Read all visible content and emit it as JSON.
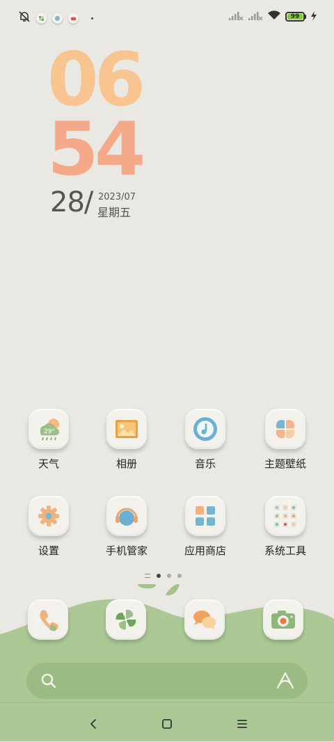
{
  "status_bar": {
    "battery_level": "99",
    "battery_color": "#7fcd33",
    "left_icons": [
      "bell-muted-icon",
      "pinwheel-app-icon",
      "security-app-icon",
      "app-store-icon"
    ],
    "right_icons": [
      "signal-no-service-icon",
      "signal-no-service-icon",
      "wifi-icon",
      "battery-icon",
      "charging-bolt-icon"
    ]
  },
  "clock": {
    "hour": "06",
    "minute": "54",
    "day": "28/",
    "year_month": "2023/07",
    "weekday": "星期五",
    "hour_color": "#f8c591",
    "minute_color": "#f5a988"
  },
  "apps": [
    {
      "label": "天气",
      "icon": "weather-icon",
      "temp": "29°"
    },
    {
      "label": "相册",
      "icon": "gallery-icon"
    },
    {
      "label": "音乐",
      "icon": "music-icon"
    },
    {
      "label": "主题壁纸",
      "icon": "themes-icon"
    },
    {
      "label": "设置",
      "icon": "settings-gear-icon"
    },
    {
      "label": "手机管家",
      "icon": "security-headphones-icon"
    },
    {
      "label": "应用商店",
      "icon": "app-store-grid-icon"
    },
    {
      "label": "系统工具",
      "icon": "tools-folder-icon"
    }
  ],
  "page_indicator": {
    "pages": 3,
    "current": 1
  },
  "dock": [
    {
      "icon": "phone-icon"
    },
    {
      "icon": "pinwheel-icon"
    },
    {
      "icon": "messages-icon"
    },
    {
      "icon": "camera-icon"
    }
  ],
  "search_bar": {
    "left_icon": "search-icon",
    "right_icon": "assistant-logo-icon"
  },
  "nav_bar": {
    "buttons": [
      "back-icon",
      "home-icon",
      "menu-icon"
    ]
  },
  "colors": {
    "background": "#e9e8e2",
    "hill": "#acc995",
    "search": "#9bbb85"
  }
}
